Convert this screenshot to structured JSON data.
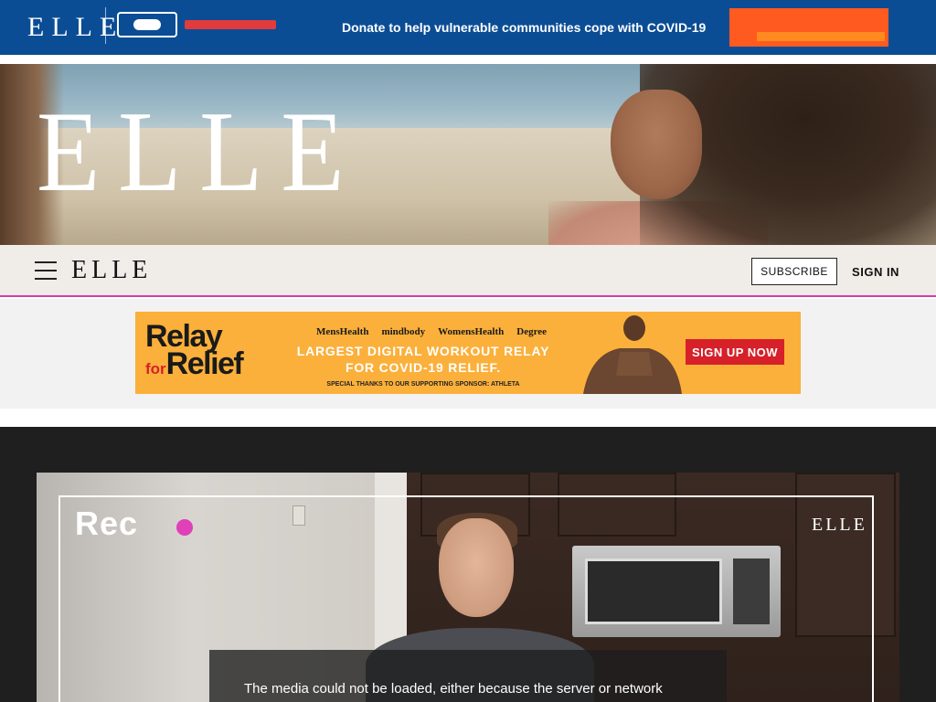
{
  "topbar": {
    "logo": "ELLE",
    "donate_text": "Donate to help vulnerable communities cope with COVID-19",
    "background_color": "#0b4d95",
    "button_color": "#ff5a1f"
  },
  "hero": {
    "logo": "ELLE"
  },
  "nav": {
    "menu_icon": "hamburger-menu-icon",
    "logo": "ELLE",
    "subscribe_label": "SUBSCRIBE",
    "signin_label": "SIGN IN",
    "accent_color": "#d23fa9"
  },
  "ad": {
    "relay_word": "Relay",
    "for_word": "for",
    "relief_word": "Relief",
    "sponsors": [
      "MensHealth",
      "mindbody",
      "WomensHealth",
      "Degree"
    ],
    "headline_line1": "LARGEST DIGITAL WORKOUT RELAY",
    "headline_line2": "FOR COVID-19 RELIEF.",
    "thanks": "SPECIAL THANKS TO OUR SUPPORTING SPONSOR: ATHLETA",
    "cta": "SIGN UP NOW",
    "background_color": "#fbb03b",
    "cta_color": "#d6202a"
  },
  "video": {
    "rec_label": "Rec",
    "watermark": "ELLE",
    "error_text": "The media could not be loaded, either because the server or network",
    "rec_dot_color": "#e040b8"
  }
}
